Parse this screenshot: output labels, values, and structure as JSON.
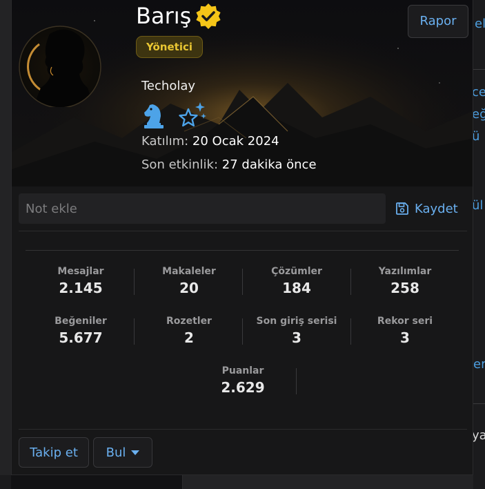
{
  "profile": {
    "name": "Barış",
    "role": "Yönetici",
    "team": "Techolay",
    "joined_label": "Katılım:",
    "joined_value": "20 Ocak 2024",
    "last_seen_label": "Son etkinlik:",
    "last_seen_value": "27 dakika önce",
    "report_label": "Rapor"
  },
  "note": {
    "placeholder": "Not ekle",
    "save_label": "Kaydet"
  },
  "stats": [
    {
      "label": "Mesajlar",
      "value": "2.145"
    },
    {
      "label": "Makaleler",
      "value": "20"
    },
    {
      "label": "Çözümler",
      "value": "184"
    },
    {
      "label": "Yazılımlar",
      "value": "258"
    },
    {
      "label": "Beğeniler",
      "value": "5.677"
    },
    {
      "label": "Rozetler",
      "value": "2"
    },
    {
      "label": "Son giriş serisi",
      "value": "3"
    },
    {
      "label": "Rekor seri",
      "value": "3"
    },
    {
      "label": "Puanlar",
      "value": "2.629"
    }
  ],
  "actions": {
    "follow_label": "Takip et",
    "find_label": "Bul"
  },
  "background_fragments": [
    "el",
    "ce",
    "eğ",
    "ü",
    "ül",
    "er",
    "ya"
  ],
  "colors": {
    "accent": "#6ab0f0",
    "role_badge": "#e8c532",
    "verified": "#f5c518",
    "card_bg": "#171718"
  }
}
